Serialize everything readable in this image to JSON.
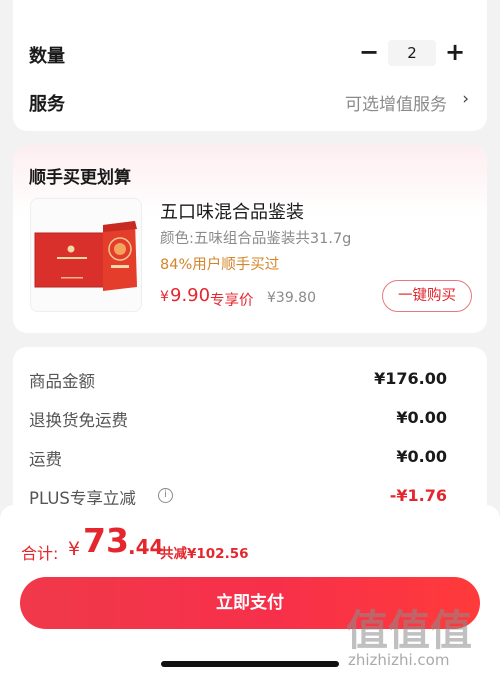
{
  "quantity_section": {
    "quantity_label": "数量",
    "minus": "−",
    "value": "2",
    "plus": "+",
    "service_label": "服务",
    "service_value": "可选增值服务",
    "service_chevron": "›"
  },
  "bundle": {
    "title": "顺手买更划算",
    "product": {
      "name": "五口味混合品鉴装",
      "spec": "颜色:五味组合品鉴装共31.7g",
      "rate": "84%用户顺手买过",
      "currency": "¥",
      "price": "9.90",
      "price_tag": "专享价",
      "original_price": "¥39.80",
      "buy_button": "一键购买"
    }
  },
  "amounts": {
    "rows": [
      {
        "label": "商品金额",
        "value": "¥176.00"
      },
      {
        "label": "退换货免运费",
        "value": "¥0.00"
      },
      {
        "label": "运费",
        "value": "¥0.00"
      },
      {
        "label": "PLUS专享立减",
        "value": "-¥1.76"
      }
    ],
    "discount_color": "#e4272e"
  },
  "footer": {
    "total_label": "合计:",
    "currency": "¥",
    "total_int": "73",
    "total_dec": ".44",
    "saved": "共减¥102.56",
    "pay_button": "立即支付"
  },
  "watermark": {
    "chars": "值值值",
    "url": "zhizhizhi.com"
  },
  "colors": {
    "accent_red": "#e4272e",
    "orange": "#d4842a",
    "background": "#f2f2f2"
  }
}
